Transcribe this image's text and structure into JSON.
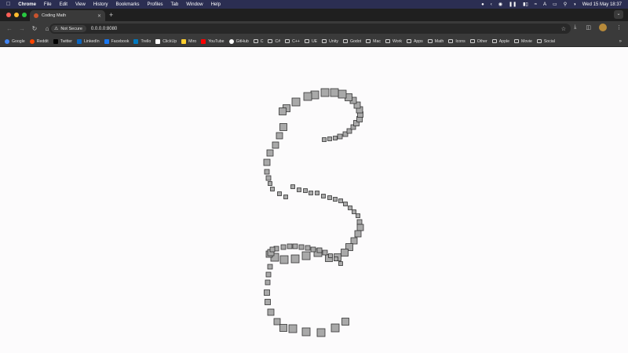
{
  "menubar": {
    "app": "Chrome",
    "items": [
      "File",
      "Edit",
      "View",
      "History",
      "Bookmarks",
      "Profiles",
      "Tab",
      "Window",
      "Help"
    ],
    "datetime": "Wed 15 May  18:37",
    "status_icons": [
      "record-icon",
      "back-icon",
      "play-icon",
      "pause-icon",
      "battery-icon",
      "wifi-icon",
      "keyboard-input-icon",
      "cast-icon",
      "search-icon",
      "control-center-icon"
    ]
  },
  "window": {
    "traffic_lights": {
      "close": "#fe5f57",
      "minimize": "#febc2e",
      "zoom": "#28c840"
    }
  },
  "tab": {
    "title": "Coding Math",
    "close_glyph": "✕",
    "new_tab_glyph": "+"
  },
  "toolbar": {
    "security_label": "Not Secure",
    "url": "0.0.0.0:8080"
  },
  "bookmarks": [
    {
      "label": "Google",
      "icon": "google-icon",
      "color": "#4285f4",
      "kind": "site"
    },
    {
      "label": "Reddit",
      "icon": "reddit-icon",
      "color": "#ff4500",
      "kind": "site"
    },
    {
      "label": "Twitter",
      "icon": "x-icon",
      "color": "#000000",
      "kind": "site"
    },
    {
      "label": "LinkedIn",
      "icon": "linkedin-icon",
      "color": "#0a66c2",
      "kind": "site"
    },
    {
      "label": "Facebook",
      "icon": "facebook-icon",
      "color": "#1877f2",
      "kind": "site"
    },
    {
      "label": "Trello",
      "icon": "trello-icon",
      "color": "#0079bf",
      "kind": "site"
    },
    {
      "label": "ClickUp",
      "icon": "clickup-icon",
      "color": "#ffffff",
      "kind": "site"
    },
    {
      "label": "Miro",
      "icon": "miro-icon",
      "color": "#ffd02f",
      "kind": "site"
    },
    {
      "label": "YouTube",
      "icon": "youtube-icon",
      "color": "#ff0000",
      "kind": "site"
    },
    {
      "label": "GitHub",
      "icon": "github-icon",
      "color": "#ffffff",
      "kind": "site"
    },
    {
      "label": "C",
      "icon": "folder-icon",
      "kind": "folder"
    },
    {
      "label": "C#",
      "icon": "folder-icon",
      "kind": "folder"
    },
    {
      "label": "C++",
      "icon": "folder-icon",
      "kind": "folder"
    },
    {
      "label": "UE",
      "icon": "folder-icon",
      "kind": "folder"
    },
    {
      "label": "Unity",
      "icon": "folder-icon",
      "kind": "folder"
    },
    {
      "label": "Godot",
      "icon": "folder-icon",
      "kind": "folder"
    },
    {
      "label": "Mac",
      "icon": "folder-icon",
      "kind": "folder"
    },
    {
      "label": "Work",
      "icon": "folder-icon",
      "kind": "folder"
    },
    {
      "label": "Apps",
      "icon": "folder-icon",
      "kind": "folder"
    },
    {
      "label": "Math",
      "icon": "folder-icon",
      "kind": "folder"
    },
    {
      "label": "Icons",
      "icon": "folder-icon",
      "kind": "folder"
    },
    {
      "label": "Other",
      "icon": "folder-icon",
      "kind": "folder"
    },
    {
      "label": "Apple",
      "icon": "folder-icon",
      "kind": "folder"
    },
    {
      "label": "Movie",
      "icon": "folder-icon",
      "kind": "folder"
    },
    {
      "label": "Social",
      "icon": "folder-icon",
      "kind": "folder"
    }
  ],
  "canvas": {
    "background": "#fcfbfc",
    "square_fill": "#a9a9a9",
    "square_stroke": "#333333"
  }
}
